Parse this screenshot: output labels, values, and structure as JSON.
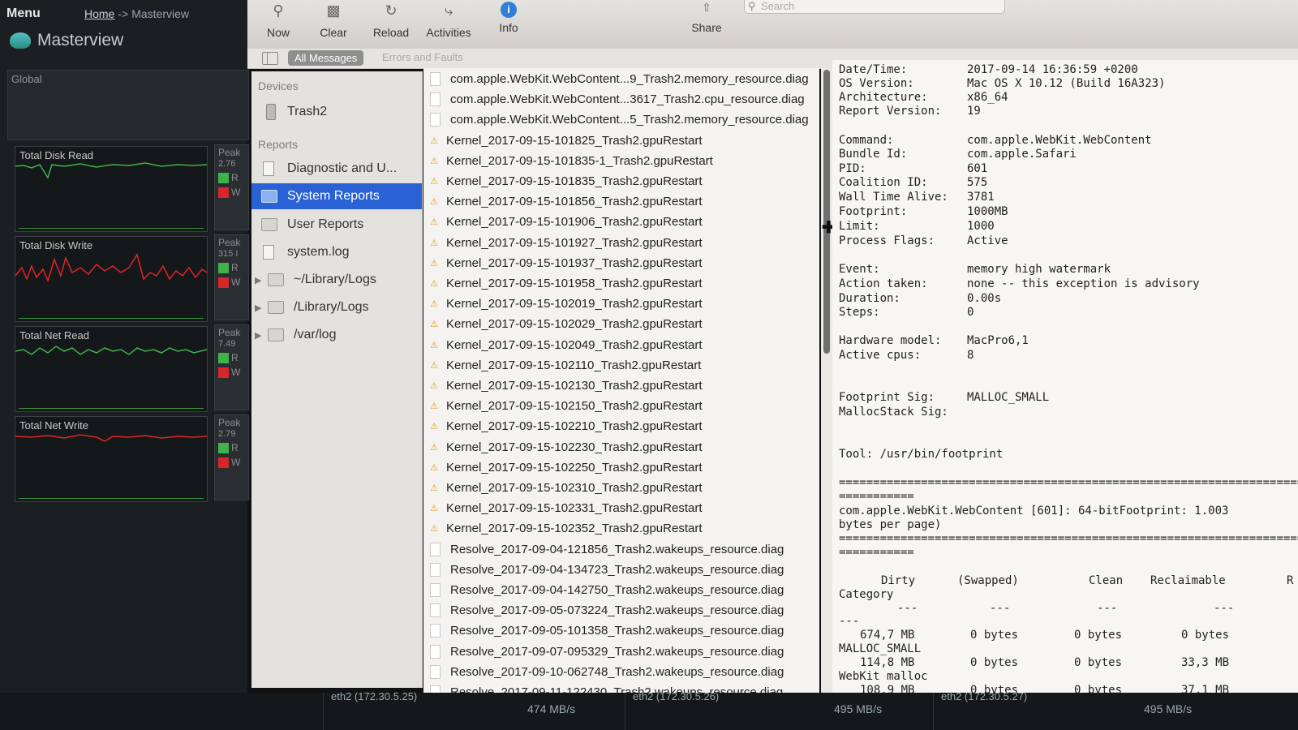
{
  "left_app": {
    "menu_label": "Menu",
    "breadcrumb": {
      "home": "Home",
      "sep": "->",
      "current": "Masterview"
    },
    "title": "Masterview",
    "global_label": "Global",
    "charts": [
      {
        "label": "Total Disk Read",
        "color": "#3fb24b"
      },
      {
        "label": "Total Disk Write",
        "color": "#e0242a"
      },
      {
        "label": "Total Net Read",
        "color": "#3fb24b"
      },
      {
        "label": "Total Net Write",
        "color": "#e0242a"
      }
    ],
    "peaks": [
      {
        "label": "Peak",
        "value": "2.76",
        "r": "R",
        "w": "W"
      },
      {
        "label": "Peak",
        "value": "315 I",
        "r": "R",
        "w": "W"
      },
      {
        "label": "Peak",
        "value": "7.49",
        "r": "R",
        "w": "W"
      },
      {
        "label": "Peak",
        "value": "2.79",
        "r": "R",
        "w": "W"
      }
    ]
  },
  "toolbar": {
    "now": "Now",
    "clear": "Clear",
    "reload": "Reload",
    "activities": "Activities",
    "info": "Info",
    "share": "Share",
    "search_placeholder": "Search"
  },
  "filterbar": {
    "all_messages": "All Messages",
    "errors_faults": "Errors and Faults"
  },
  "sidebar": {
    "devices_header": "Devices",
    "device": "Trash2",
    "reports_header": "Reports",
    "items": [
      {
        "label": "Diagnostic and U...",
        "icon": "document"
      },
      {
        "label": "System Reports",
        "icon": "folder",
        "selected": true
      },
      {
        "label": "User Reports",
        "icon": "folder"
      },
      {
        "label": "system.log",
        "icon": "document"
      },
      {
        "label": "~/Library/Logs",
        "icon": "folder",
        "disclosure": true
      },
      {
        "label": "/Library/Logs",
        "icon": "folder",
        "disclosure": true
      },
      {
        "label": "/var/log",
        "icon": "folder",
        "disclosure": true
      }
    ]
  },
  "files": [
    {
      "name": "com.apple.WebKit.WebContent...9_Trash2.memory_resource.diag",
      "icon": "doc"
    },
    {
      "name": "com.apple.WebKit.WebContent...3617_Trash2.cpu_resource.diag",
      "icon": "doc"
    },
    {
      "name": "com.apple.WebKit.WebContent...5_Trash2.memory_resource.diag",
      "icon": "doc"
    },
    {
      "name": "Kernel_2017-09-15-101825_Trash2.gpuRestart",
      "icon": "warn"
    },
    {
      "name": "Kernel_2017-09-15-101835-1_Trash2.gpuRestart",
      "icon": "warn"
    },
    {
      "name": "Kernel_2017-09-15-101835_Trash2.gpuRestart",
      "icon": "warn"
    },
    {
      "name": "Kernel_2017-09-15-101856_Trash2.gpuRestart",
      "icon": "warn"
    },
    {
      "name": "Kernel_2017-09-15-101906_Trash2.gpuRestart",
      "icon": "warn"
    },
    {
      "name": "Kernel_2017-09-15-101927_Trash2.gpuRestart",
      "icon": "warn"
    },
    {
      "name": "Kernel_2017-09-15-101937_Trash2.gpuRestart",
      "icon": "warn"
    },
    {
      "name": "Kernel_2017-09-15-101958_Trash2.gpuRestart",
      "icon": "warn"
    },
    {
      "name": "Kernel_2017-09-15-102019_Trash2.gpuRestart",
      "icon": "warn"
    },
    {
      "name": "Kernel_2017-09-15-102029_Trash2.gpuRestart",
      "icon": "warn"
    },
    {
      "name": "Kernel_2017-09-15-102049_Trash2.gpuRestart",
      "icon": "warn"
    },
    {
      "name": "Kernel_2017-09-15-102110_Trash2.gpuRestart",
      "icon": "warn"
    },
    {
      "name": "Kernel_2017-09-15-102130_Trash2.gpuRestart",
      "icon": "warn"
    },
    {
      "name": "Kernel_2017-09-15-102150_Trash2.gpuRestart",
      "icon": "warn"
    },
    {
      "name": "Kernel_2017-09-15-102210_Trash2.gpuRestart",
      "icon": "warn"
    },
    {
      "name": "Kernel_2017-09-15-102230_Trash2.gpuRestart",
      "icon": "warn"
    },
    {
      "name": "Kernel_2017-09-15-102250_Trash2.gpuRestart",
      "icon": "warn"
    },
    {
      "name": "Kernel_2017-09-15-102310_Trash2.gpuRestart",
      "icon": "warn"
    },
    {
      "name": "Kernel_2017-09-15-102331_Trash2.gpuRestart",
      "icon": "warn"
    },
    {
      "name": "Kernel_2017-09-15-102352_Trash2.gpuRestart",
      "icon": "warn"
    },
    {
      "name": "Resolve_2017-09-04-121856_Trash2.wakeups_resource.diag",
      "icon": "doc"
    },
    {
      "name": "Resolve_2017-09-04-134723_Trash2.wakeups_resource.diag",
      "icon": "doc"
    },
    {
      "name": "Resolve_2017-09-04-142750_Trash2.wakeups_resource.diag",
      "icon": "doc"
    },
    {
      "name": "Resolve_2017-09-05-073224_Trash2.wakeups_resource.diag",
      "icon": "doc"
    },
    {
      "name": "Resolve_2017-09-05-101358_Trash2.wakeups_resource.diag",
      "icon": "doc"
    },
    {
      "name": "Resolve_2017-09-07-095329_Trash2.wakeups_resource.diag",
      "icon": "doc"
    },
    {
      "name": "Resolve_2017-09-10-062748_Trash2.wakeups_resource.diag",
      "icon": "doc"
    },
    {
      "name": "Resolve_2017-09-11-122430_Trash2.wakeups_resource.diag",
      "icon": "doc"
    }
  ],
  "report": {
    "header": [
      {
        "k": "Date/Time:",
        "v": "2017-09-14 16:36:59 +0200"
      },
      {
        "k": "OS Version:",
        "v": "Mac OS X 10.12 (Build 16A323)"
      },
      {
        "k": "Architecture:",
        "v": "x86_64"
      },
      {
        "k": "Report Version:",
        "v": "19"
      }
    ],
    "process": [
      {
        "k": "Command:",
        "v": "com.apple.WebKit.WebContent"
      },
      {
        "k": "Bundle Id:",
        "v": "com.apple.Safari"
      },
      {
        "k": "PID:",
        "v": "601"
      },
      {
        "k": "Coalition ID:",
        "v": "575"
      },
      {
        "k": "Wall Time Alive:",
        "v": "3781"
      },
      {
        "k": "Footprint:",
        "v": "1000MB"
      },
      {
        "k": "Limit:",
        "v": "1000"
      },
      {
        "k": "Process Flags:",
        "v": "Active"
      }
    ],
    "event": [
      {
        "k": "Event:",
        "v": "memory high watermark"
      },
      {
        "k": "Action taken:",
        "v": "none -- this exception is advisory"
      },
      {
        "k": "Duration:",
        "v": "0.00s"
      },
      {
        "k": "Steps:",
        "v": "0"
      }
    ],
    "hardware": [
      {
        "k": "Hardware model:",
        "v": "MacPro6,1"
      },
      {
        "k": "Active cpus:",
        "v": "8"
      }
    ],
    "sigs": [
      {
        "k": "Footprint Sig:",
        "v": "MALLOC_SMALL"
      },
      {
        "k": "MallocStack Sig:",
        "v": ""
      }
    ],
    "tool": "Tool: /usr/bin/footprint",
    "rule_long": "==========================================================================",
    "rule_short": "===========",
    "footprint_line1": "com.apple.WebKit.WebContent [601]: 64-bitFootprint: 1.003",
    "footprint_line2": "bytes per page)",
    "table_headers": [
      "Dirty",
      "(Swapped)",
      "Clean",
      "Reclaimable",
      "R"
    ],
    "category_label": "Category",
    "dash": "---",
    "rows": [
      {
        "dirty": "674,7 MB",
        "swapped": "0 bytes",
        "clean": "0 bytes",
        "reclaimable": "0 bytes",
        "category": "MALLOC_SMALL"
      },
      {
        "dirty": "114,8 MB",
        "swapped": "0 bytes",
        "clean": "0 bytes",
        "reclaimable": "33,3 MB",
        "category": "WebKit malloc"
      },
      {
        "dirty": "108,9 MB",
        "swapped": "0 bytes",
        "clean": "0 bytes",
        "reclaimable": "37,1 MB",
        "category": ""
      }
    ]
  },
  "bottom": {
    "items": [
      {
        "label": "eth2 (172.30.5.25)",
        "value": "474 MB/s"
      },
      {
        "label": "eth2 (172.30.5.26)",
        "value": "495 MB/s"
      },
      {
        "label": "eth2 (172.30.5.27)",
        "value": "495 MB/s"
      }
    ]
  }
}
